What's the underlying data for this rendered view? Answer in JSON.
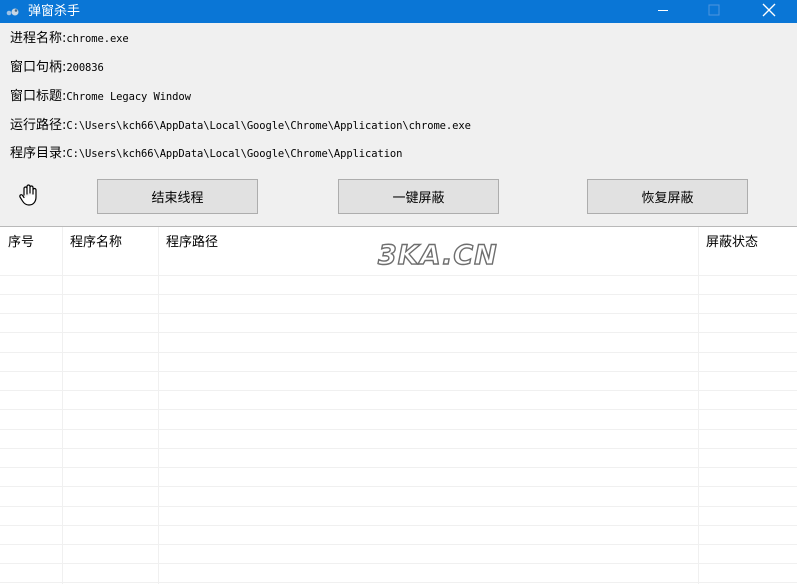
{
  "window": {
    "title": "弹窗杀手",
    "controls": {
      "minimize": "minimize",
      "maximize": "maximize",
      "close": "close"
    }
  },
  "info": [
    {
      "label": "进程名称:",
      "value": "chrome.exe"
    },
    {
      "label": "窗口句柄:",
      "value": "200836"
    },
    {
      "label": "窗口标题:",
      "value": "Chrome Legacy Window"
    },
    {
      "label": "运行路径:",
      "value": "C:\\Users\\kch66\\AppData\\Local\\Google\\Chrome\\Application\\chrome.exe"
    },
    {
      "label": "程序目录:",
      "value": "C:\\Users\\kch66\\AppData\\Local\\Google\\Chrome\\Application"
    }
  ],
  "toolbar": {
    "end_thread": "结束线程",
    "one_key_block": "一键屏蔽",
    "restore_block": "恢复屏蔽"
  },
  "table": {
    "columns": [
      "序号",
      "程序名称",
      "程序路径",
      "屏蔽状态"
    ],
    "watermark": "3KA.CN",
    "rows": []
  },
  "icons": {
    "app": "app-icon",
    "hand": "hand-icon"
  },
  "colors": {
    "titlebar": "#0a76d6",
    "background": "#f0f0f0",
    "button": "#e1e1e1"
  }
}
